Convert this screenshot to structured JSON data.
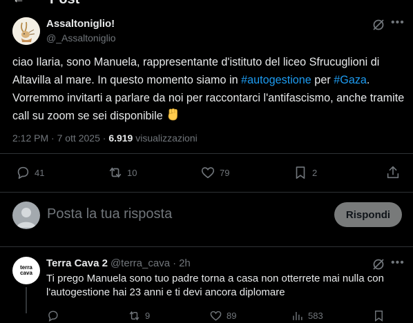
{
  "header": {
    "back_icon": "arrow-left-icon",
    "title": "Post"
  },
  "post": {
    "author_name": "Assaltoniglio!",
    "author_handle": "@_Assaltoniglio",
    "text_part1": "ciao Ilaria, sono Manuela, rappresentante d'istituto del liceo Sfrucuglioni di Altavilla al mare. In questo momento siamo in ",
    "hashtag1": "#autogestione",
    "text_part2": " per ",
    "hashtag2": "#Gaza",
    "text_part3": ". Vorremmo invitarti a parlare da noi per raccontarci l'antifascismo, anche tramite call su zoom se sei disponibile ",
    "emoji_icon": "raised-fist-icon",
    "timestamp": "2:12 PM · 7 ott 2025",
    "views_count": "6.919",
    "views_label": " visualizzazioni",
    "replies": "41",
    "reposts": "10",
    "likes": "79",
    "bookmarks": "2"
  },
  "reply_box": {
    "placeholder": "Posta la tua risposta",
    "button_label": "Rispondi"
  },
  "comment": {
    "avatar_text_1": "terra",
    "avatar_text_2": "cava",
    "author_name": "Terra Cava 2",
    "author_handle": "@terra_cava",
    "separator": "·",
    "time": "2h",
    "text": "Ti prego Manuela sono tuo padre torna a casa non otterrete mai nulla con l'autogestione hai 23 anni e ti devi ancora diplomare",
    "reposts": "9",
    "likes": "89",
    "views": "583"
  },
  "colors": {
    "link": "#1d9bf0",
    "muted": "#71767b",
    "text": "#e7e9ea",
    "background": "#000000",
    "divider": "#2f3336"
  }
}
